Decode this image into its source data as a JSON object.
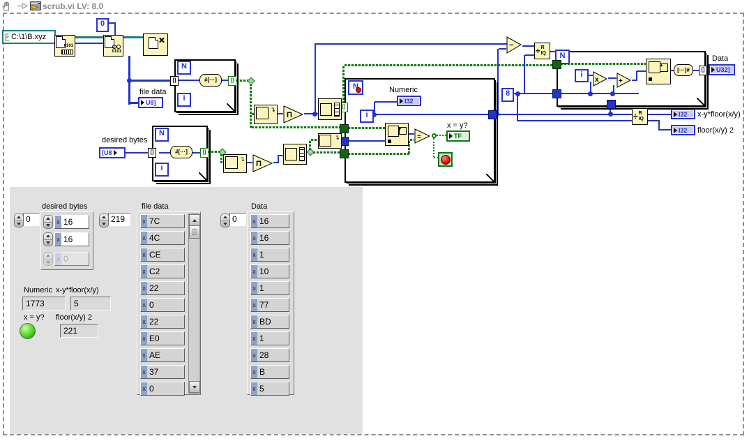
{
  "titlebar": {
    "title": "scrub.vi LV: 8.0"
  },
  "glyphs": {
    "n": "N",
    "i": "i",
    "bits": "0101",
    "arr_size": "#[···]",
    "arr_build": "[···]#",
    "pi": "Π",
    "mul": "x",
    "add": "+",
    "sub": "−",
    "eq": "=",
    "div": "÷",
    "rem": "R",
    "quo": "IQ",
    "tunnel": "[]",
    "zero": "0",
    "eight": "8",
    "bend_arrow": "↴",
    "plus_small": "+"
  },
  "diagram": {
    "path_constant": "C:\\1\\B.xyz",
    "labels": {
      "file_data": "file data",
      "desired_bytes": "desired bytes",
      "numeric": "Numeric",
      "x_eq_y": "x = y?",
      "data": "Data",
      "xy_floor": "x-y*floor(x/y)",
      "floor2": "floor(x/y) 2"
    },
    "terminals": {
      "u8_ctrl": "[U8",
      "u8_ind": "U8]",
      "i32": "I32",
      "u32": "U32]",
      "tf": "TF"
    }
  },
  "panel": {
    "desired_bytes": {
      "label": "desired bytes",
      "index": "0",
      "radix": "x",
      "values": [
        "16",
        "16",
        "0"
      ]
    },
    "file_data": {
      "label": "file data",
      "index": "219",
      "radix": "x",
      "values": [
        "7C",
        "4C",
        "CE",
        "C2",
        "22",
        "0",
        "22",
        "E0",
        "AE",
        "37",
        "0"
      ]
    },
    "data_array": {
      "label": "Data",
      "index": "0",
      "radix": "x",
      "values": [
        "16",
        "16",
        "1",
        "10",
        "1",
        "77",
        "BD",
        "1",
        "28",
        "B",
        "5"
      ]
    },
    "numeric": {
      "label": "Numeric",
      "value": "1773"
    },
    "xy_floor": {
      "label": "x-y*floor(x/y)",
      "value": "5"
    },
    "x_eq_y": {
      "label": "x = y?"
    },
    "floor2": {
      "label": "floor(x/y) 2",
      "value": "221"
    }
  },
  "colors": {
    "wire_blue": "#2233cc",
    "wire_teal": "#1e7f7f",
    "array_green": "#117a11",
    "node_yellow": "#fbf5bd",
    "led_green": "#3ed314",
    "stop_red": "#dd1111"
  }
}
